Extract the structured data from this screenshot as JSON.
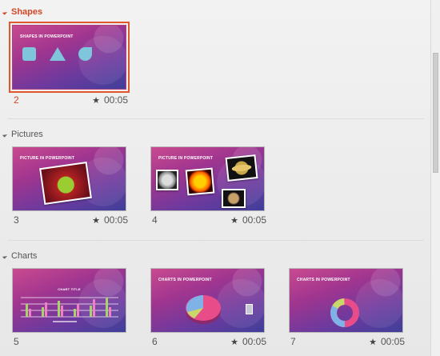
{
  "sections": [
    {
      "title": "Shapes",
      "selected": true,
      "slides": [
        {
          "number": "2",
          "title": "SHAPES IN POWERPOINT",
          "timing": "00:05",
          "selected": true
        }
      ]
    },
    {
      "title": "Pictures",
      "selected": false,
      "slides": [
        {
          "number": "3",
          "title": "PICTURE IN POWERPOINT",
          "timing": "00:05"
        },
        {
          "number": "4",
          "title": "PICTURE IN POWERPOINT",
          "timing": "00:05"
        }
      ]
    },
    {
      "title": "Charts",
      "selected": false,
      "slides": [
        {
          "number": "5",
          "title": "CHART TITLE",
          "timing": ""
        },
        {
          "number": "6",
          "title": "CHARTS IN POWERPOINT",
          "timing": "00:05"
        },
        {
          "number": "7",
          "title": "CHARTS IN POWERPOINT",
          "timing": "00:05"
        }
      ]
    }
  ],
  "colors": {
    "accent": "#d24726",
    "selection_border": "#e0572e"
  },
  "icons": {
    "timing": "star-icon",
    "collapse": "triangle-icon"
  }
}
